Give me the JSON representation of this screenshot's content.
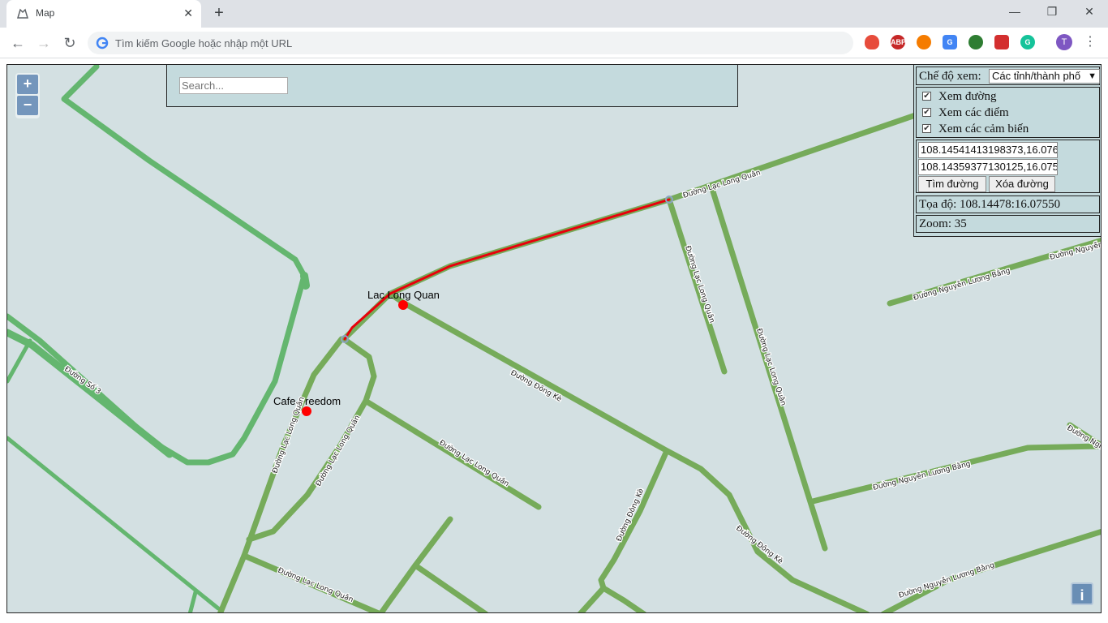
{
  "browser": {
    "tab_title": "Map",
    "tab_close": "✕",
    "new_tab": "+",
    "omnibox_placeholder": "Tìm kiếm Google hoặc nhập một URL",
    "avatar_initial": "T",
    "window_controls": [
      "—",
      "❐",
      "✕"
    ]
  },
  "map": {
    "zoom_in": "+",
    "zoom_out": "−",
    "info": "i",
    "search_placeholder": "Search...",
    "points": [
      {
        "label": "Lac Long Quan"
      },
      {
        "label": "Cafe Freedom"
      }
    ],
    "street_labels": [
      "Đường Lạc Long Quân",
      "Đường Số 3",
      "Đường Đông Kè",
      "Đường Nguyễn Lương Bằng",
      "Đường Ngh"
    ],
    "colors": {
      "background": "#d3e0e2",
      "road_primary": "#76ab5a",
      "road_secondary": "#64b66f",
      "route": "#e8000b",
      "point": "#ff0000"
    }
  },
  "controls": {
    "mode_label": "Chế độ xem:",
    "mode_value": "Các tỉnh/thành phố",
    "checkboxes": [
      {
        "label": "Xem đường",
        "checked": true
      },
      {
        "label": "Xem các điểm",
        "checked": true
      },
      {
        "label": "Xem các cảm biến",
        "checked": true
      }
    ],
    "start_coord": "108.14541413198373,16.076",
    "end_coord": "108.14359377130125,16.075",
    "find_route": "Tìm đường",
    "clear_route": "Xóa đường",
    "position_text": "Tọa độ: 108.14478:16.07550",
    "zoom_text": "Zoom: 35"
  }
}
